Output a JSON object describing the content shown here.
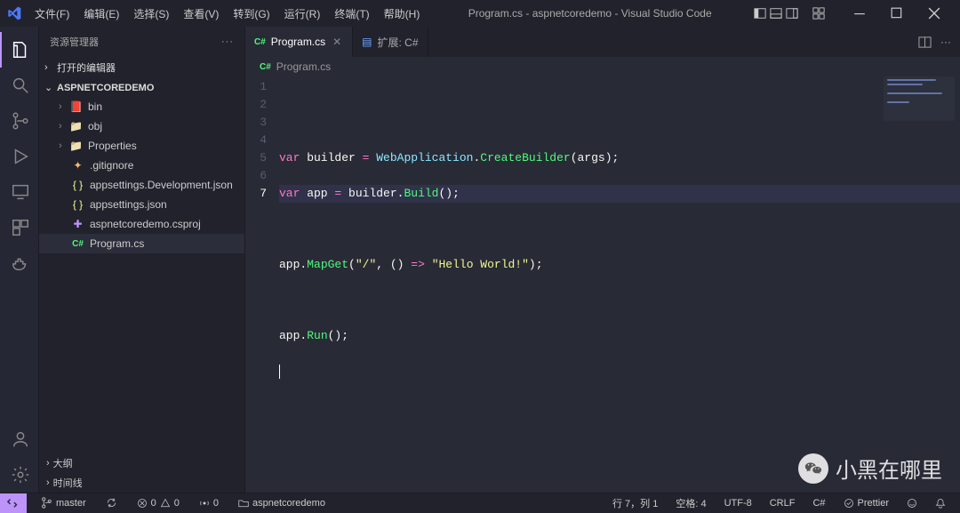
{
  "window": {
    "title": "Program.cs - aspnetcoredemo - Visual Studio Code"
  },
  "menu": {
    "file": "文件(F)",
    "edit": "编辑(E)",
    "select": "选择(S)",
    "view": "查看(V)",
    "goto": "转到(G)",
    "run": "运行(R)",
    "terminal": "终端(T)",
    "help": "帮助(H)"
  },
  "sidebar": {
    "title": "资源管理器",
    "open_editors": "打开的编辑器",
    "project": "ASPNETCOREDEMO",
    "items": [
      {
        "name": "bin",
        "kind": "folder",
        "color": "#ff5555"
      },
      {
        "name": "obj",
        "kind": "folder",
        "color": "#6272a4"
      },
      {
        "name": "Properties",
        "kind": "folder",
        "color": "#6272a4"
      },
      {
        "name": ".gitignore",
        "kind": "file",
        "iconcolor": "#ffb86c"
      },
      {
        "name": "appsettings.Development.json",
        "kind": "file",
        "iconcolor": "#f1fa8c"
      },
      {
        "name": "appsettings.json",
        "kind": "file",
        "iconcolor": "#f1fa8c"
      },
      {
        "name": "aspnetcoredemo.csproj",
        "kind": "file",
        "iconcolor": "#bd93f9"
      },
      {
        "name": "Program.cs",
        "kind": "file",
        "iconcolor": "#50fa7b",
        "selected": true
      }
    ],
    "outline": "大纲",
    "timeline": "时间线"
  },
  "tabs": {
    "active": "Program.cs",
    "ext": "扩展: C#"
  },
  "breadcrumb": {
    "fileicon": "C#",
    "file": "Program.cs"
  },
  "code": {
    "l1a": "var",
    "l1b": " builder ",
    "l1eq": "=",
    "l1c": " WebApplication",
    "l1d": ".",
    "l1e": "CreateBuilder",
    "l1f": "(args);",
    "l2a": "var",
    "l2b": " app ",
    "l2eq": "=",
    "l2c": " builder",
    "l2d": ".",
    "l2e": "Build",
    "l2f": "();",
    "l4a": "app",
    "l4b": ".",
    "l4c": "MapGet",
    "l4d": "(",
    "l4e": "\"/\"",
    "l4f": ", () ",
    "l4g": "=>",
    "l4h": " ",
    "l4i": "\"Hello World!\"",
    "l4j": ");",
    "l6a": "app",
    "l6b": ".",
    "l6c": "Run",
    "l6d": "();",
    "lines": [
      "1",
      "2",
      "3",
      "4",
      "5",
      "6",
      "7"
    ]
  },
  "status": {
    "branch": "master",
    "sync": "",
    "errors": "0",
    "warnings": "0",
    "port": "0",
    "folder": "aspnetcoredemo",
    "lncol": "行 7，列 1",
    "spaces": "空格: 4",
    "enc": "UTF-8",
    "eol": "CRLF",
    "lang": "C#",
    "prettier": "Prettier"
  },
  "watermark": "小黑在哪里"
}
